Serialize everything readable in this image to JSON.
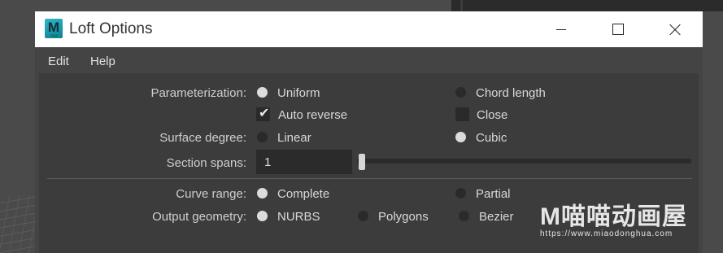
{
  "window": {
    "title": "Loft Options",
    "icon_letter": "M",
    "icon_name": "maya-app-icon"
  },
  "menu": [
    "Edit",
    "Help"
  ],
  "form": {
    "parameterization": {
      "label": "Parameterization:",
      "options": [
        "Uniform",
        "Chord length"
      ],
      "selected": "Uniform"
    },
    "auto_reverse": {
      "label": "Auto reverse",
      "checked": true
    },
    "close": {
      "label": "Close",
      "checked": false
    },
    "surface_degree": {
      "label": "Surface degree:",
      "options": [
        "Linear",
        "Cubic"
      ],
      "selected": "Cubic"
    },
    "section_spans": {
      "label": "Section spans:",
      "value": "1"
    },
    "curve_range": {
      "label": "Curve range:",
      "options": [
        "Complete",
        "Partial"
      ],
      "selected": "Complete"
    },
    "output_geometry": {
      "label": "Output geometry:",
      "options": [
        "NURBS",
        "Polygons",
        "Bezier"
      ],
      "selected": "NURBS"
    }
  },
  "watermark": {
    "text": "M喵喵动画屋",
    "url": "https://www.miaodonghua.com"
  }
}
